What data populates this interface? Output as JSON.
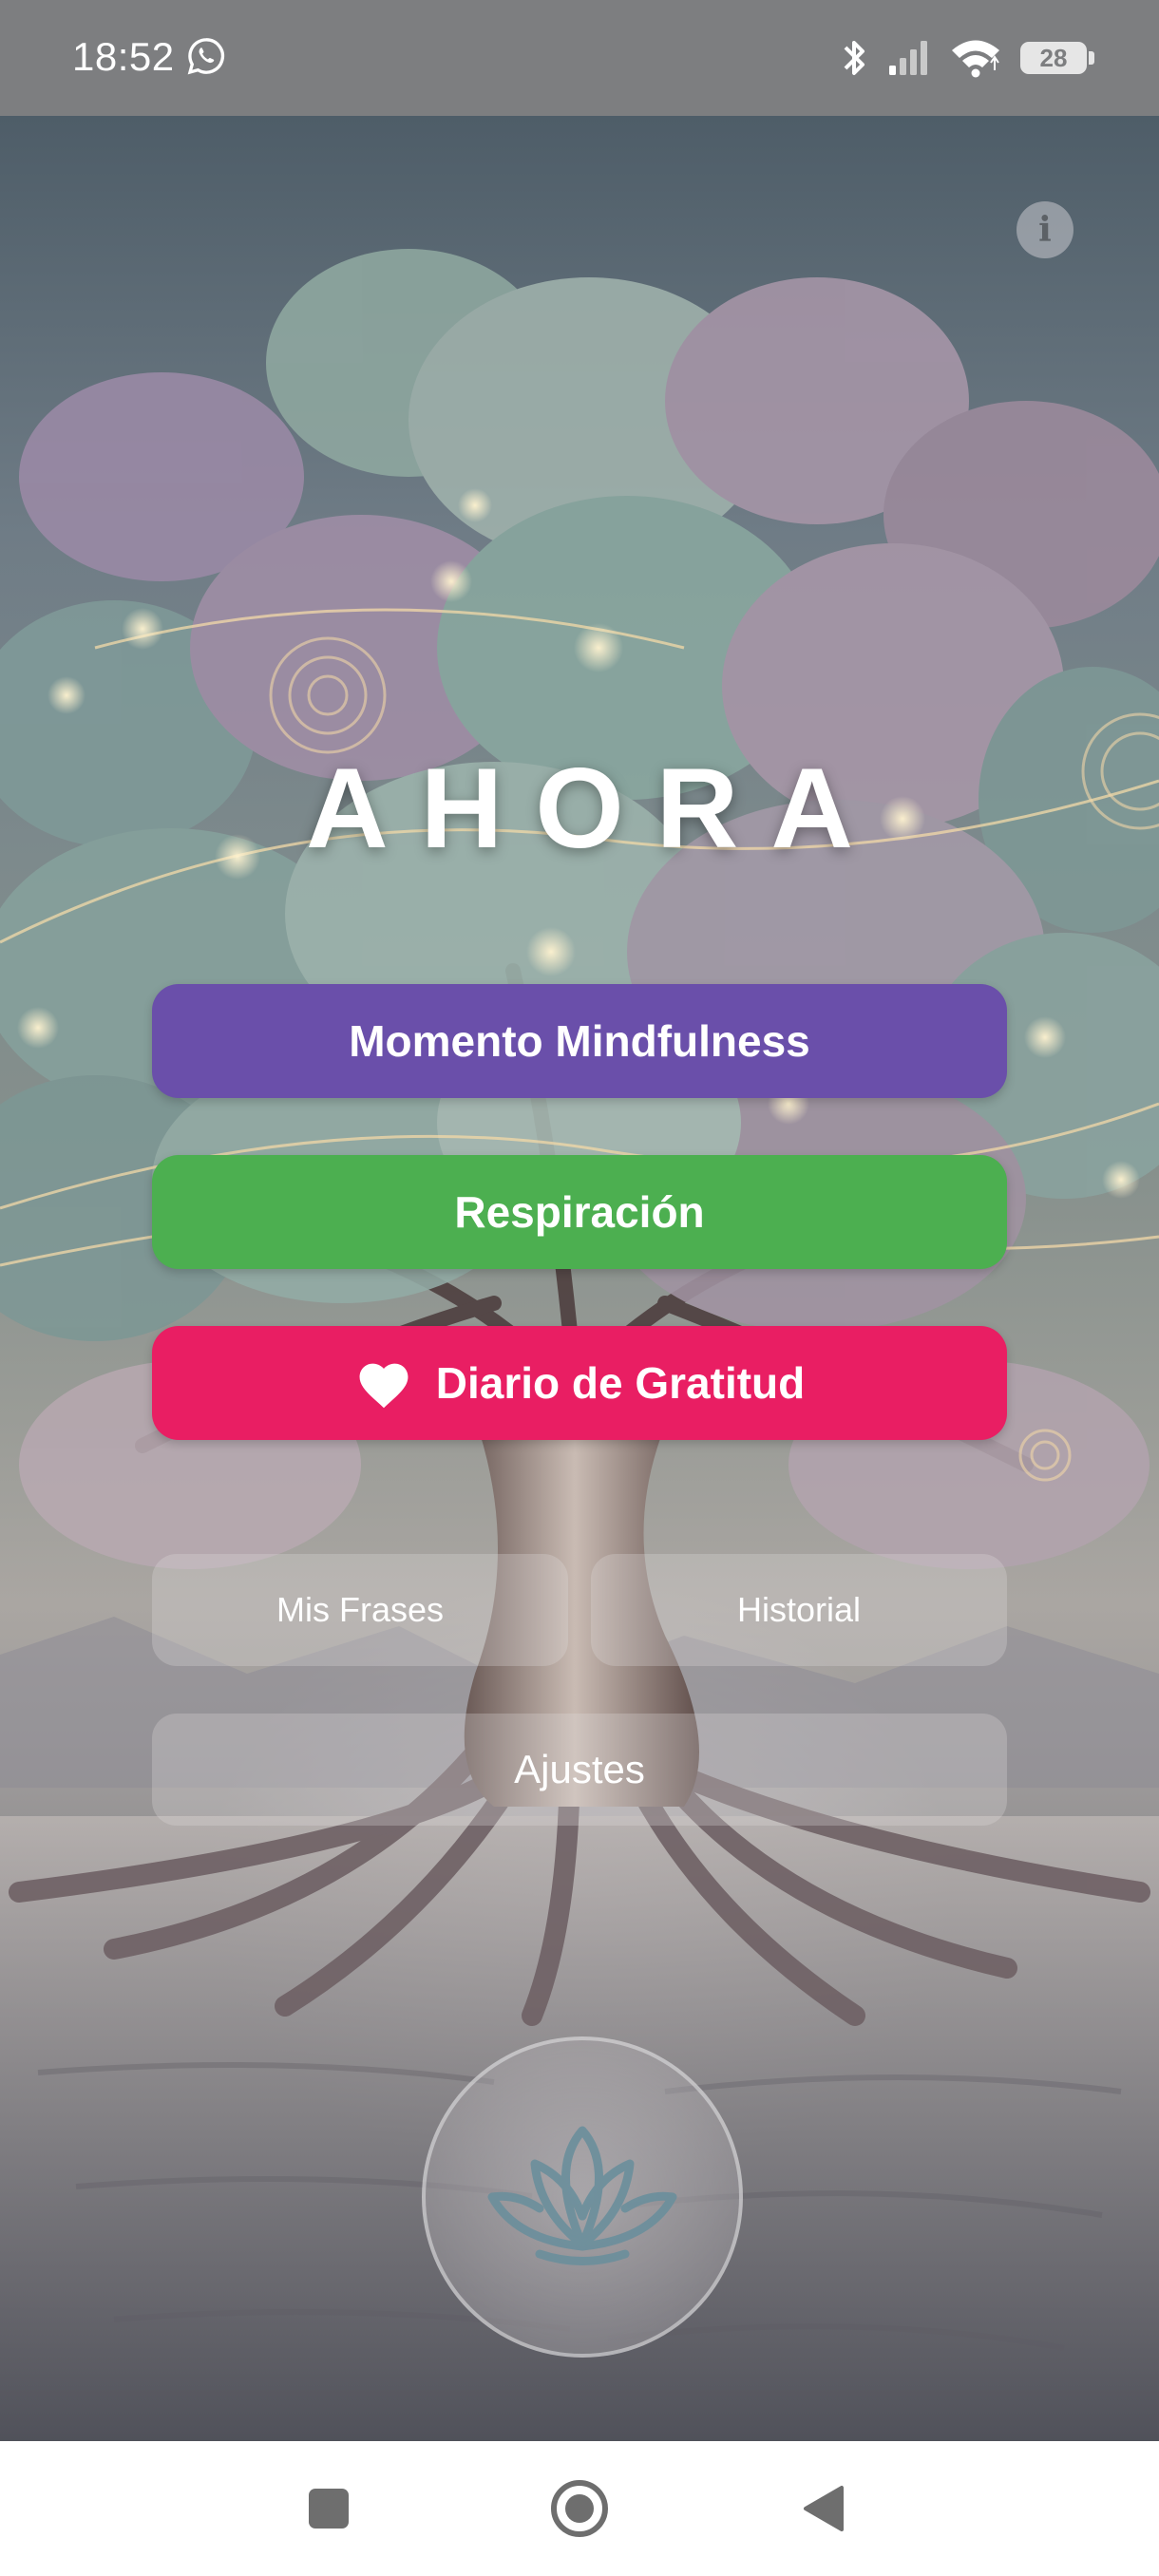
{
  "status_bar": {
    "time": "18:52",
    "battery": "28",
    "icons": [
      "whatsapp-icon",
      "bluetooth-icon",
      "signal-icon",
      "wifi-icon",
      "battery-icon"
    ]
  },
  "app": {
    "title": "AHORA",
    "info_icon": "i"
  },
  "buttons": {
    "mindfulness": "Momento Mindfulness",
    "respiracion": "Respiración",
    "gratitud": "Diario de Gratitud",
    "mis_frases": "Mis Frases",
    "historial": "Historial",
    "ajustes": "Ajustes"
  },
  "colors": {
    "mindfulness": "#6a4faa",
    "respiracion": "#4caf50",
    "gratitud": "#e91e63"
  },
  "navigation": [
    "recents",
    "home",
    "back"
  ]
}
